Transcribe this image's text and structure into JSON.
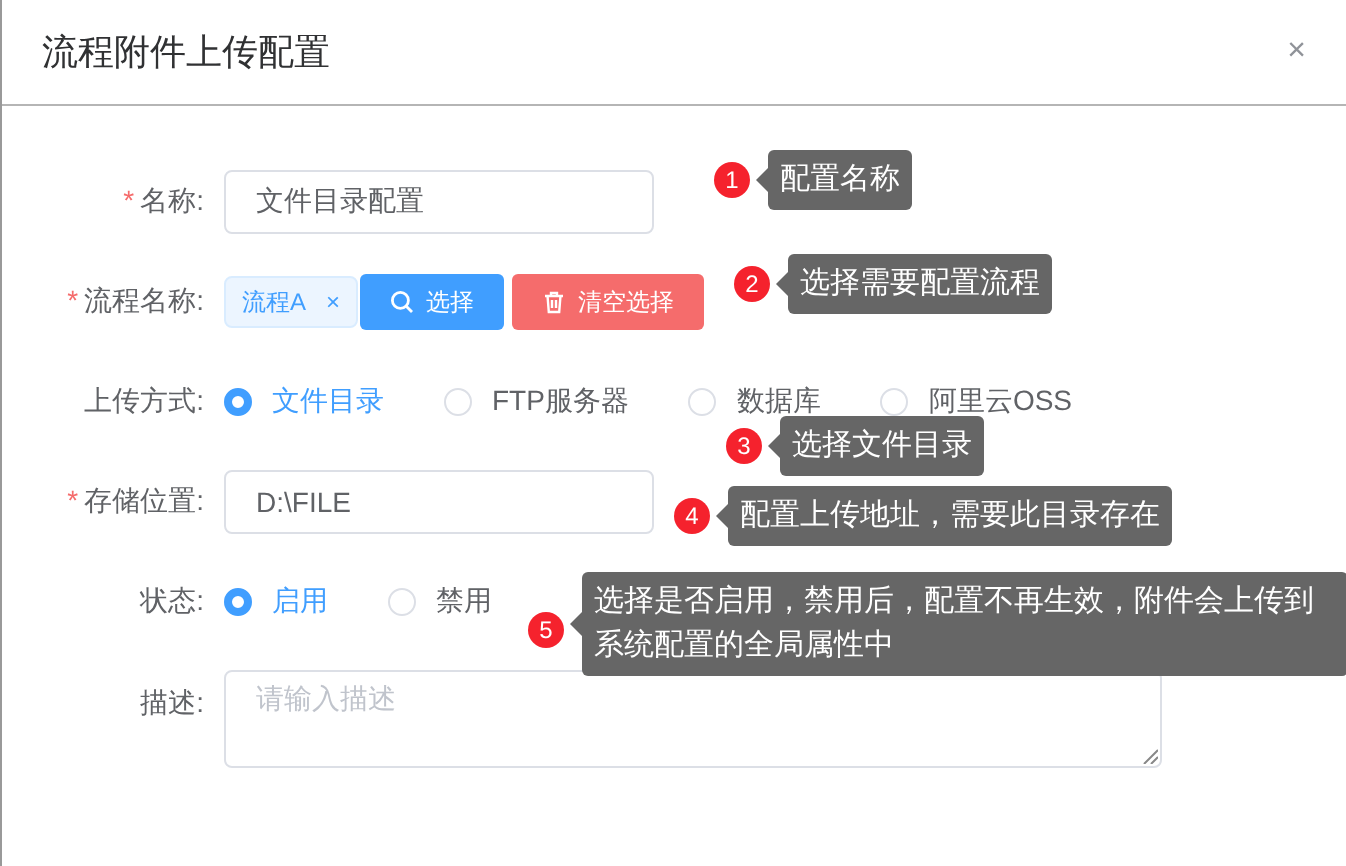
{
  "dialog": {
    "title": "流程附件上传配置",
    "close": "×"
  },
  "fields": [
    {
      "kind": "input",
      "label": "名称:",
      "required_mark": "*",
      "value": "文件目录配置"
    },
    {
      "kind": "tags",
      "label": "流程名称:",
      "required_mark": "*",
      "tags": [
        {
          "text": "流程A",
          "close": "×"
        }
      ],
      "buttons": [
        {
          "label": "选择",
          "kind": "primary"
        },
        {
          "label": "清空选择",
          "kind": "danger"
        }
      ]
    },
    {
      "kind": "radio",
      "label": "上传方式:",
      "options": [
        {
          "label": "文件目录",
          "selected": true
        },
        {
          "label": "FTP服务器",
          "selected": false
        },
        {
          "label": "数据库",
          "selected": false
        },
        {
          "label": "阿里云OSS",
          "selected": false
        }
      ]
    },
    {
      "kind": "input",
      "label": "存储位置:",
      "required_mark": "*",
      "value": "D:\\FILE"
    },
    {
      "kind": "radio",
      "label": "状态:",
      "options": [
        {
          "label": "启用",
          "selected": true
        },
        {
          "label": "禁用",
          "selected": false
        }
      ]
    },
    {
      "kind": "textarea",
      "label": "描述:",
      "placeholder": "请输入描述"
    }
  ],
  "annotations": [
    {
      "number": "1",
      "text": "配置名称"
    },
    {
      "number": "2",
      "text": "选择需要配置流程"
    },
    {
      "number": "3",
      "text": "选择文件目录"
    },
    {
      "number": "4",
      "text": "配置上传地址，需要此目录存在"
    },
    {
      "number": "5",
      "text": "选择是否启用，禁用后，配置不再生效，附件会上传到系统配置的全局属性中"
    }
  ]
}
